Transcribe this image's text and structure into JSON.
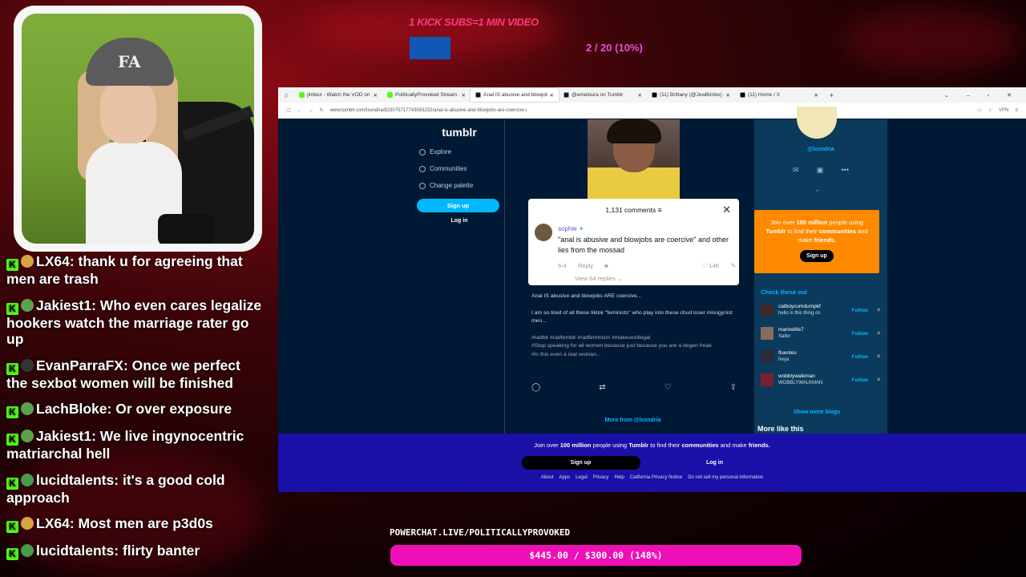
{
  "overlay": {
    "sub_goal": "1 KICK SUBS=1 MIN VIDEO",
    "progress_text": "2 / 20 (10%)",
    "powerchat_url": "POWERCHAT.LIVE/POLITICALLYPROVOKED",
    "donation_text": "$445.00 / $300.00 (148%)"
  },
  "chat": [
    {
      "user": "LX64",
      "text": "thank u for agreeing that men are trash",
      "badge_color": "#d9a441"
    },
    {
      "user": "Jakiest1",
      "text": "Who even cares legalize hookers watch the marriage rater go up",
      "badge_color": "#5aa34a"
    },
    {
      "user": "EvanParraFX",
      "text": "Once we perfect the sexbot women will be finished",
      "badge_color": "#333333"
    },
    {
      "user": "LachBloke",
      "text": "Or over exposure",
      "badge_color": "#5aa34a"
    },
    {
      "user": "Jakiest1",
      "text": "We live ingynocentric matriarchal hell",
      "badge_color": "#5aa34a"
    },
    {
      "user": "lucidtalents",
      "text": "it's a good cold approach",
      "badge_color": "#4a9a4a"
    },
    {
      "user": "LX64",
      "text": "Most men are p3d0s",
      "badge_color": "#d9a441"
    },
    {
      "user": "lucidtalents",
      "text": "flirty banter",
      "badge_color": "#4a9a4a"
    }
  ],
  "browser": {
    "tabs": [
      {
        "label": "jimboz - Watch the VOD on Kic",
        "fav": "#53fc18"
      },
      {
        "label": "PoliticallyProvoked Stream - W",
        "fav": "#53fc18"
      },
      {
        "label": "Anal IS abusive and blowjobs",
        "fav": "#001935"
      },
      {
        "label": "@emeloura on Tumblr",
        "fav": "#001935"
      },
      {
        "label": "(11) Brittany (@JewBimbo) / X",
        "fav": "#000000"
      },
      {
        "label": "(11) Home / X",
        "fav": "#000000"
      }
    ],
    "url": "www.tumblr.com/lxxndria/823075717743583232/anal-is-abusive-and-blowjobs-are-coercive-i",
    "vpn_label": "VPN"
  },
  "tumblr": {
    "logo": "tumblr",
    "nav": [
      "Explore",
      "Communities",
      "Change palette"
    ],
    "signup": "Sign up",
    "login": "Log in",
    "comments_count": "1,131 comments",
    "comment_user": "sophie",
    "comment_text": "\"anal is abusive and blowjobs are coercive\" and other lies from the mossad",
    "comment_age": "6-4",
    "reply_label": "Reply",
    "like_count": "14K",
    "view_replies": "View 64 replies",
    "post_title": "Anal IS abusive and blowjobs ARE coercive...",
    "post_para": "I am so tired of all these tiktok \"feminists\" who play into these chud loser misogynist men...",
    "post_tags": "#radblr   #radfemblr   #radfeminism   #makesexillegal",
    "post_tag2": "#Stop speaking for all women because just because you are a degen freak",
    "post_tag3": "#Is this even a real woman...",
    "more_from": "More from @lxxndria",
    "blog_name": "@lxxndria",
    "join_text_1": "Join over ",
    "join_bold_1": "100 million",
    "join_text_2": " people using ",
    "join_bold_2": "Tumblr",
    "join_text_3": " to find their ",
    "join_bold_3": "communities",
    "join_text_4": " and make ",
    "join_bold_4": "friends.",
    "check_out": "Check these out",
    "suggestions": [
      {
        "name": "catboycumdumpkf",
        "sub": "hello is this thing on",
        "follow": "Follow"
      },
      {
        "name": "marinelife7",
        "sub": "Sailor",
        "follow": "Follow"
      },
      {
        "name": "fluentes",
        "sub": "freya",
        "follow": "Follow"
      },
      {
        "name": "wobblywalkman",
        "sub": "WOBBLYWALKMAN",
        "follow": "Follow"
      }
    ],
    "show_more": "Show more blogs",
    "more_like": "More like this",
    "footer_links": [
      "About",
      "Apps",
      "Legal",
      "Privacy",
      "Help",
      "California Privacy Notice",
      "Do not sell my personal information"
    ]
  }
}
